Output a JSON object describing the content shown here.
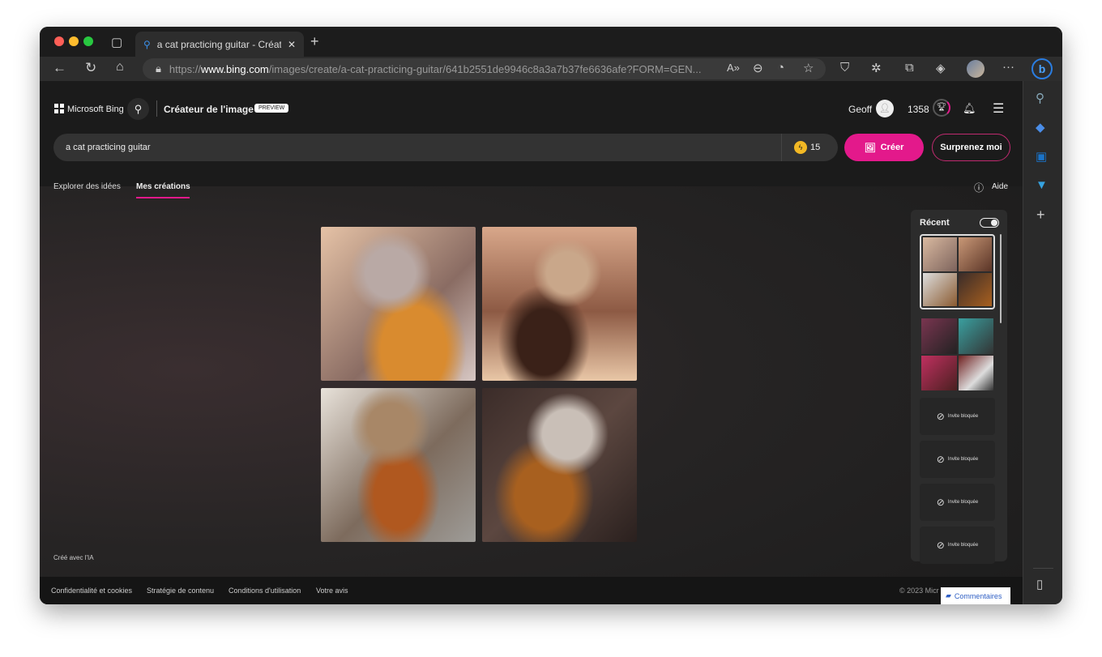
{
  "browser": {
    "tab_title": "a cat practicing guitar - Créateur de l'image",
    "url_prefix": "https://",
    "url_domain": "www.bing.com",
    "url_path": "/images/create/a-cat-practicing-guitar/641b2551de9946c8a3a7b37fe6636afe?FORM=GEN..."
  },
  "header": {
    "brand": "Microsoft Bing",
    "product": "Créateur de l'image",
    "badge": "PREVIEW",
    "user": "Geoff",
    "points": "1358"
  },
  "search": {
    "value": "a cat practicing guitar",
    "boosts": "15",
    "create_label": "Créer",
    "surprise_label": "Surprenez moi"
  },
  "tabs": [
    {
      "label": "Explorer des idées"
    },
    {
      "label": "Mes créations",
      "active": true
    }
  ],
  "help_label": "Aide",
  "recent": {
    "title": "Récent",
    "blocked_label": "Invite bloquée"
  },
  "ai_note": "Créé avec l'IA",
  "footer": {
    "links": [
      "Confidentialité et cookies",
      "Stratégie de contenu",
      "Conditions d'utilisation",
      "Votre avis"
    ],
    "copyright": "© 2023 Micr",
    "feedback": "Commentaires"
  },
  "colors": {
    "accent": "#e3198b",
    "page_bg": "#1b1b1b"
  }
}
